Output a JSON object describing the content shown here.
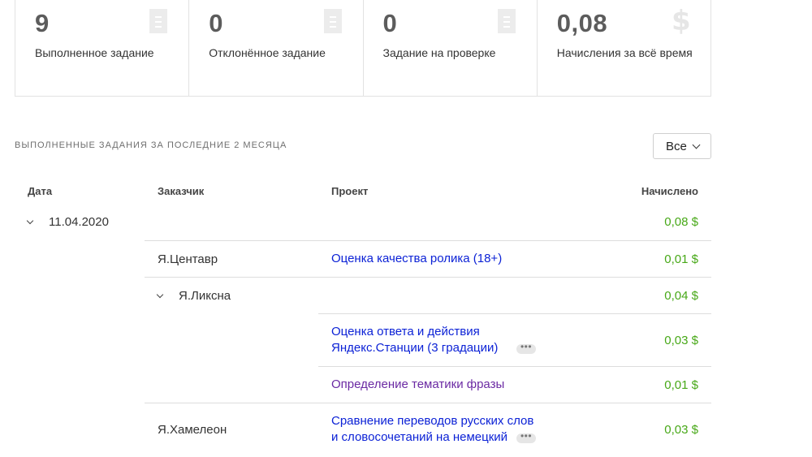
{
  "stats": [
    {
      "value": "9",
      "label": "Выполненное задание",
      "icon": "document-icon"
    },
    {
      "value": "0",
      "label": "Отклонённое задание",
      "icon": "document-icon"
    },
    {
      "value": "0",
      "label": "Задание на проверке",
      "icon": "document-icon"
    },
    {
      "value": "0,08",
      "label": "Начисления за всё время",
      "icon": "dollar-icon",
      "icon_glyph": "$"
    }
  ],
  "section": {
    "title": "ВЫПОЛНЕННЫЕ ЗАДАНИЯ ЗА ПОСЛЕДНИЕ 2 МЕСЯЦА",
    "filter_value": "Все"
  },
  "table": {
    "headers": {
      "date": "Дата",
      "customer": "Заказчик",
      "project": "Проект",
      "earned": "Начислено"
    },
    "date_group": {
      "date": "11.04.2020",
      "amount": "0,08 $"
    },
    "rows": [
      {
        "customer": "Я.Центавр",
        "project": "Оценка качества ролика (18+)",
        "amount": "0,01 $"
      },
      {
        "customer": "Я.Ликсна",
        "amount": "0,04 $"
      },
      {
        "project_line1": "Оценка ответа и действия",
        "project_line2": "Яндекс.Станции (3 градации)",
        "amount": "0,03 $"
      },
      {
        "project": "Определение тематики фразы",
        "amount": "0,01 $"
      },
      {
        "customer": "Я.Хамелеон",
        "project_line1": "Сравнение переводов русских слов",
        "project_line2": "и словосочетаний на немецкий",
        "amount": "0,03 $"
      }
    ],
    "more_glyph": "•••"
  },
  "colors": {
    "amount": "#47a817",
    "link": "#0c22d6",
    "visited_link": "#6b2aa3"
  }
}
